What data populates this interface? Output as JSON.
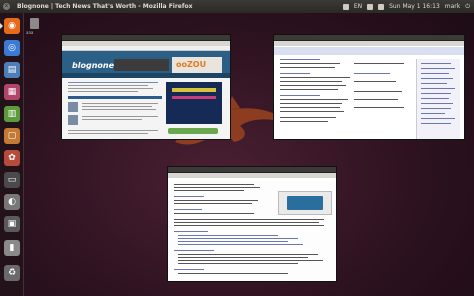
{
  "top_panel": {
    "window_title": "Blognone | Tech News That's Worth - Mozilla Firefox",
    "close_glyph": "x",
    "tray": {
      "keyboard": "EN",
      "time": "Sun May  1 16:13",
      "user": "mark",
      "power": "⏻"
    }
  },
  "launcher": {
    "items": [
      {
        "name": "firefox",
        "glyph": "◉",
        "color": "#e66a1a"
      },
      {
        "name": "chromium",
        "glyph": "◎",
        "color": "#3b7bd6"
      },
      {
        "name": "document",
        "glyph": "▤",
        "color": "#4d7eb8"
      },
      {
        "name": "presentation",
        "glyph": "▦",
        "color": "#b2456a"
      },
      {
        "name": "spreadsheet",
        "glyph": "▥",
        "color": "#5d9a3c"
      },
      {
        "name": "files",
        "glyph": "▢",
        "color": "#c47a33"
      },
      {
        "name": "software-center",
        "glyph": "✿",
        "color": "#b54b3a"
      },
      {
        "name": "terminal",
        "glyph": "▭",
        "color": "#4a4a4a"
      },
      {
        "name": "settings",
        "glyph": "◐",
        "color": "#777777"
      },
      {
        "name": "workspace",
        "glyph": "▣",
        "color": "#5a5a5a"
      },
      {
        "name": "disk",
        "glyph": "▮",
        "color": "#8a8a8a"
      },
      {
        "name": "trash",
        "glyph": "♻",
        "color": "#6a6a6a"
      }
    ]
  },
  "desktop": {
    "file_label": "aaa"
  },
  "windows": {
    "blognone": {
      "logo": "blognone",
      "ad_text": "ooZOU"
    }
  }
}
